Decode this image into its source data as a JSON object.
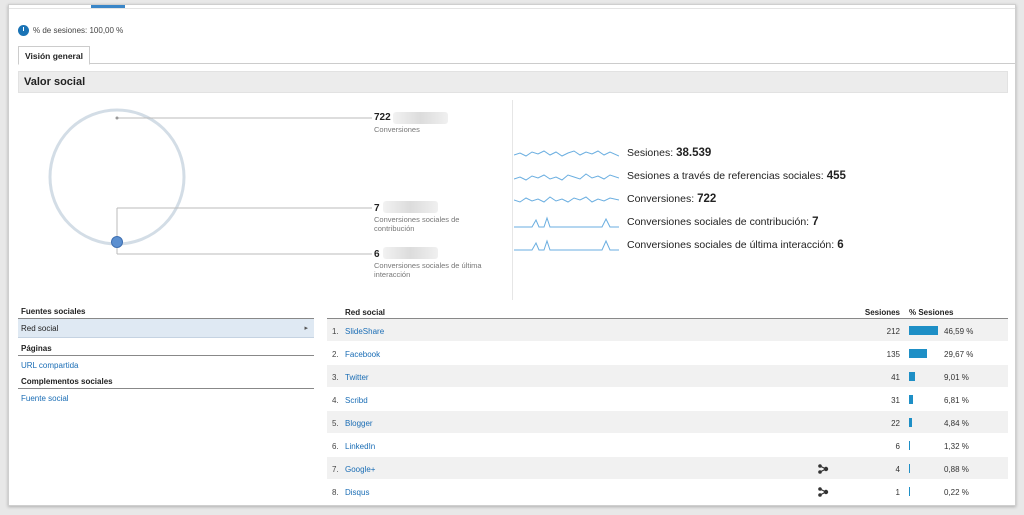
{
  "segment": {
    "label": "% de sesiones: 100,00 %"
  },
  "tabs": [
    {
      "label": "Visión general"
    }
  ],
  "section": {
    "title": "Valor social"
  },
  "diagram": {
    "total": {
      "value": "722",
      "label": "Conversiones"
    },
    "assisted": {
      "value": "7",
      "label": "Conversiones sociales de contribución"
    },
    "last": {
      "value": "6",
      "label": "Conversiones sociales de última interacción"
    }
  },
  "metrics": [
    {
      "label": "Sesiones:",
      "value": "38.539"
    },
    {
      "label": "Sesiones a través de referencias sociales:",
      "value": "455"
    },
    {
      "label": "Conversiones:",
      "value": "722"
    },
    {
      "label": "Conversiones sociales de contribución:",
      "value": "7"
    },
    {
      "label": "Conversiones sociales de última interacción:",
      "value": "6"
    }
  ],
  "left_panel": {
    "groups": [
      {
        "header": "Fuentes sociales",
        "items": [
          {
            "label": "Red social",
            "selected": true
          }
        ]
      },
      {
        "header": "Páginas",
        "items": [
          {
            "label": "URL compartida"
          }
        ]
      },
      {
        "header": "Complementos sociales",
        "items": [
          {
            "label": "Fuente social"
          }
        ]
      }
    ]
  },
  "table": {
    "headers": {
      "network": "Red social",
      "sessions": "Sesiones",
      "pct": "% Sesiones"
    },
    "rows": [
      {
        "index": "1.",
        "network": "SlideShare",
        "sessions": "212",
        "pct": "46,59 %",
        "share": 0.4659,
        "share_icon": false
      },
      {
        "index": "2.",
        "network": "Facebook",
        "sessions": "135",
        "pct": "29,67 %",
        "share": 0.2967,
        "share_icon": false
      },
      {
        "index": "3.",
        "network": "Twitter",
        "sessions": "41",
        "pct": "9,01 %",
        "share": 0.0901,
        "share_icon": false
      },
      {
        "index": "4.",
        "network": "Scribd",
        "sessions": "31",
        "pct": "6,81 %",
        "share": 0.0681,
        "share_icon": false
      },
      {
        "index": "5.",
        "network": "Blogger",
        "sessions": "22",
        "pct": "4,84 %",
        "share": 0.0484,
        "share_icon": false
      },
      {
        "index": "6.",
        "network": "LinkedIn",
        "sessions": "6",
        "pct": "1,32 %",
        "share": 0.0132,
        "share_icon": false
      },
      {
        "index": "7.",
        "network": "Google+",
        "sessions": "4",
        "pct": "0,88 %",
        "share": 0.0088,
        "share_icon": true
      },
      {
        "index": "8.",
        "network": "Disqus",
        "sessions": "1",
        "pct": "0,22 %",
        "share": 0.0022,
        "share_icon": true
      }
    ]
  },
  "colors": {
    "accent": "#1e8fc6",
    "link": "#1a6db5",
    "sparkline": "#6aaee0",
    "circle": "#d3dde6"
  }
}
